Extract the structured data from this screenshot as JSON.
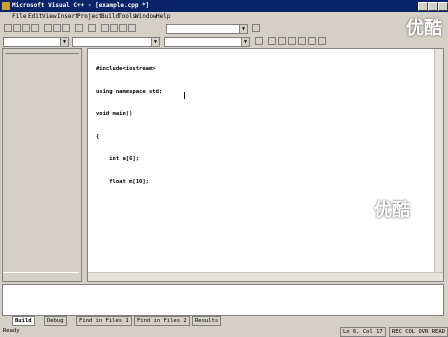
{
  "window": {
    "title": "Microsoft Visual C++ - [example.cpp *]"
  },
  "menu": {
    "items": [
      "File",
      "Edit",
      "View",
      "Insert",
      "Project",
      "Build",
      "Tools",
      "Window",
      "Help"
    ]
  },
  "code": {
    "lines": [
      "#include<iostream>",
      "using namespace std;",
      "void main()",
      "{",
      "    int a[6];",
      "    float m[10];",
      "",
      "",
      "",
      "",
      "",
      "}"
    ]
  },
  "output_tabs": [
    "Build",
    "Debug",
    "Find in Files 1",
    "Find in Files 2",
    "Results"
  ],
  "status": {
    "ready": "Ready",
    "position": "Ln 6, Col 17",
    "flags": "REC COL OVR READ"
  },
  "watermark": "优酷",
  "colors": {
    "titlebar": "#0a246a",
    "editor_bg": "#ffffff",
    "chrome": "#d4d0c8"
  }
}
